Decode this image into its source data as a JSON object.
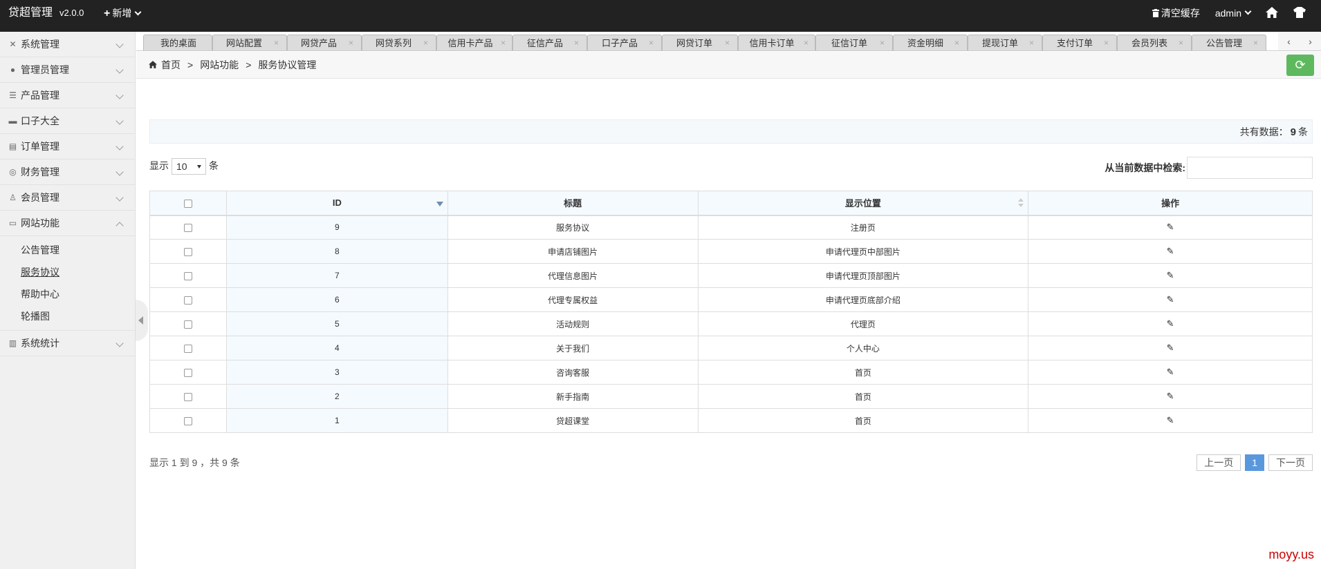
{
  "topbar": {
    "brand": "贷超管理",
    "version": "v2.0.0",
    "new_label": "新增",
    "clear_cache": "清空缓存",
    "user": "admin"
  },
  "sidebar": {
    "items": [
      {
        "label": "系统管理",
        "icon": "wrench-icon"
      },
      {
        "label": "管理员管理",
        "icon": "user-icon"
      },
      {
        "label": "产品管理",
        "icon": "list-icon"
      },
      {
        "label": "口子大全",
        "icon": "card-icon"
      },
      {
        "label": "订单管理",
        "icon": "document-icon"
      },
      {
        "label": "财务管理",
        "icon": "database-icon"
      },
      {
        "label": "会员管理",
        "icon": "member-icon"
      },
      {
        "label": "网站功能",
        "icon": "web-icon"
      }
    ],
    "sub_items": [
      "公告管理",
      "服务协议",
      "帮助中心",
      "轮播图"
    ],
    "last_item": {
      "label": "系统统计",
      "icon": "stats-icon"
    }
  },
  "tabs": [
    "我的桌面",
    "网站配置",
    "网贷产品",
    "网贷系列",
    "信用卡产品",
    "征信产品",
    "口子产品",
    "网贷订单",
    "信用卡订单",
    "征信订单",
    "资金明细",
    "提现订单",
    "支付订单",
    "会员列表",
    "公告管理"
  ],
  "breadcrumb": {
    "home": "首页",
    "level1": "网站功能",
    "level2": "服务协议管理",
    "sep": ">"
  },
  "summary": {
    "prefix": "共有数据：",
    "count": "9",
    "suffix": "条"
  },
  "length_control": {
    "prefix": "显示",
    "value": "10",
    "suffix": "条"
  },
  "search": {
    "label": "从当前数据中检索:",
    "value": ""
  },
  "table": {
    "headers": [
      "ID",
      "标题",
      "显示位置",
      "操作"
    ],
    "rows": [
      {
        "id": "9",
        "title": "服务协议",
        "position": "注册页"
      },
      {
        "id": "8",
        "title": "申请店铺图片",
        "position": "申请代理页中部图片"
      },
      {
        "id": "7",
        "title": "代理信息图片",
        "position": "申请代理页顶部图片"
      },
      {
        "id": "6",
        "title": "代理专属权益",
        "position": "申请代理页底部介绍"
      },
      {
        "id": "5",
        "title": "活动规则",
        "position": "代理页"
      },
      {
        "id": "4",
        "title": "关于我们",
        "position": "个人中心"
      },
      {
        "id": "3",
        "title": "咨询客服",
        "position": "首页"
      },
      {
        "id": "2",
        "title": "新手指南",
        "position": "首页"
      },
      {
        "id": "1",
        "title": "贷超课堂",
        "position": "首页"
      }
    ]
  },
  "pagination": {
    "info": "显示 1 到 9 ，共 9 条",
    "prev": "上一页",
    "current": "1",
    "next": "下一页"
  },
  "watermark": "moyy.us",
  "colors": {
    "topbar": "#222222",
    "refresh": "#5eb95e",
    "current_page": "#5a98de"
  }
}
